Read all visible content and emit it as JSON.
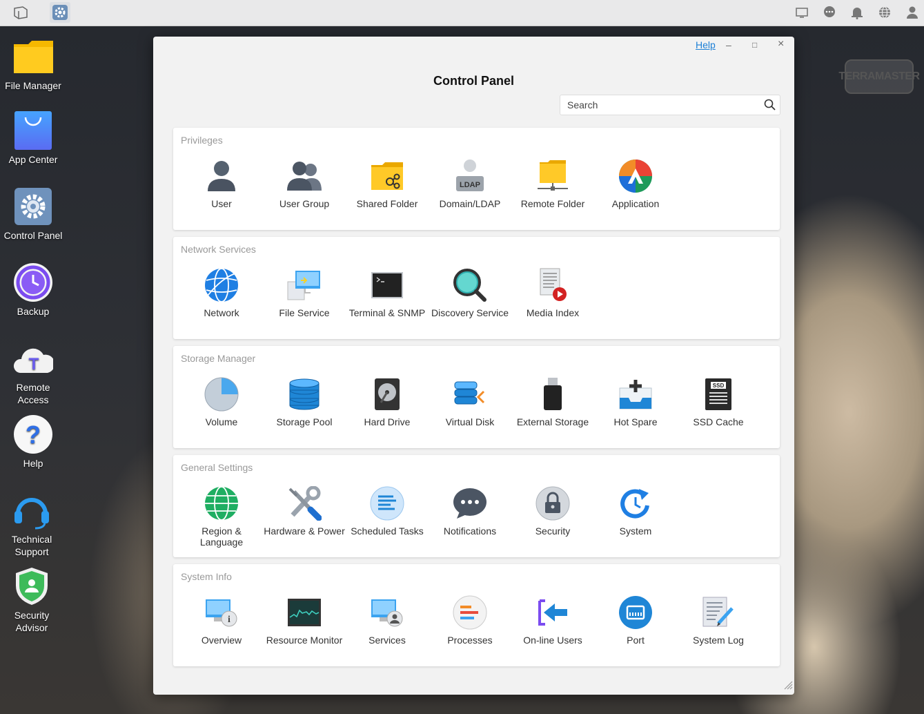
{
  "desktop": {
    "items": [
      {
        "label": "File Manager",
        "icon": "folder-icon"
      },
      {
        "label": "App Center",
        "icon": "shopping-bag-icon"
      },
      {
        "label": "Control Panel",
        "icon": "gear-icon"
      },
      {
        "label": "Backup",
        "icon": "clock-icon"
      },
      {
        "label": "Remote Access",
        "icon": "cloud-icon"
      },
      {
        "label": "Help",
        "icon": "question-icon"
      },
      {
        "label": "Technical Support",
        "icon": "headset-icon"
      },
      {
        "label": "Security Advisor",
        "icon": "shield-icon"
      }
    ],
    "brand": "TERRAMASTER"
  },
  "window": {
    "title": "Control Panel",
    "help": "Help",
    "minimize": "–",
    "maximize": "□",
    "close": "×",
    "search_placeholder": "Search"
  },
  "sections": [
    {
      "title": "Privileges",
      "items": [
        {
          "label": "User",
          "icon": "user-icon"
        },
        {
          "label": "User Group",
          "icon": "user-group-icon"
        },
        {
          "label": "Shared Folder",
          "icon": "shared-folder-icon"
        },
        {
          "label": "Domain/LDAP",
          "icon": "ldap-icon",
          "badge": "LDAP"
        },
        {
          "label": "Remote Folder",
          "icon": "remote-folder-icon"
        },
        {
          "label": "Application",
          "icon": "application-icon"
        }
      ]
    },
    {
      "title": "Network Services",
      "items": [
        {
          "label": "Network",
          "icon": "globe-icon"
        },
        {
          "label": "File Service",
          "icon": "file-service-icon"
        },
        {
          "label": "Terminal & SNMP",
          "icon": "terminal-icon"
        },
        {
          "label": "Discovery Service",
          "icon": "magnifier-icon"
        },
        {
          "label": "Media Index",
          "icon": "media-index-icon"
        }
      ]
    },
    {
      "title": "Storage Manager",
      "items": [
        {
          "label": "Volume",
          "icon": "pie-icon"
        },
        {
          "label": "Storage Pool",
          "icon": "database-icon"
        },
        {
          "label": "Hard Drive",
          "icon": "hard-drive-icon"
        },
        {
          "label": "Virtual Disk",
          "icon": "virtual-disk-icon"
        },
        {
          "label": "External Storage",
          "icon": "usb-drive-icon"
        },
        {
          "label": "Hot Spare",
          "icon": "hot-spare-icon"
        },
        {
          "label": "SSD Cache",
          "icon": "ssd-icon",
          "badge": "SSD"
        }
      ]
    },
    {
      "title": "General Settings",
      "items": [
        {
          "label": "Region & Language",
          "icon": "region-globe-icon"
        },
        {
          "label": "Hardware & Power",
          "icon": "tools-icon"
        },
        {
          "label": "Scheduled Tasks",
          "icon": "tasks-icon"
        },
        {
          "label": "Notifications",
          "icon": "chat-bubble-icon"
        },
        {
          "label": "Security",
          "icon": "lock-icon"
        },
        {
          "label": "System",
          "icon": "system-refresh-icon"
        }
      ]
    },
    {
      "title": "System Info",
      "items": [
        {
          "label": "Overview",
          "icon": "overview-icon"
        },
        {
          "label": "Resource Monitor",
          "icon": "monitor-chart-icon"
        },
        {
          "label": "Services",
          "icon": "services-icon"
        },
        {
          "label": "Processes",
          "icon": "processes-icon"
        },
        {
          "label": "On-line Users",
          "icon": "online-users-icon"
        },
        {
          "label": "Port",
          "icon": "port-icon"
        },
        {
          "label": "System Log",
          "icon": "system-log-icon"
        }
      ]
    }
  ]
}
